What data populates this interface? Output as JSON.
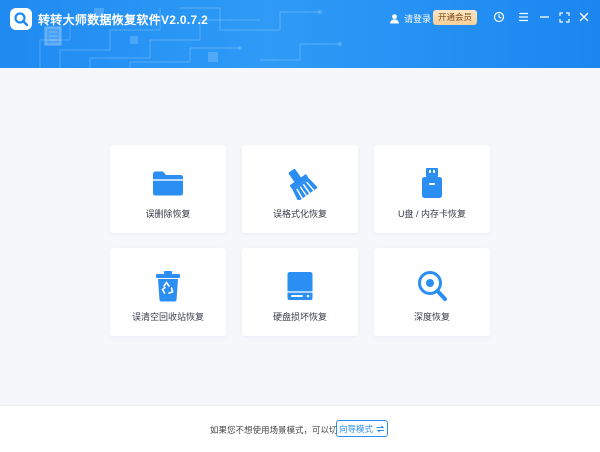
{
  "app": {
    "title": "转转大师数据恢复软件V2.0.7.2",
    "logo_icon": "q-magnifier-icon"
  },
  "header": {
    "login_label": "请登录",
    "vip_label": "开通会员",
    "icons": [
      "user-icon",
      "refresh-icon",
      "menu-icon",
      "minimize-icon",
      "maximize-icon",
      "close-icon"
    ]
  },
  "modes": [
    {
      "label": "误删除恢复",
      "icon": "folder-icon"
    },
    {
      "label": "误格式化恢复",
      "icon": "broom-icon"
    },
    {
      "label": "U盘 / 内存卡恢复",
      "icon": "usb-drive-icon"
    },
    {
      "label": "误清空回收站恢复",
      "icon": "recycle-bin-icon"
    },
    {
      "label": "硬盘损坏恢复",
      "icon": "hard-disk-icon"
    },
    {
      "label": "深度恢复",
      "icon": "deep-scan-icon"
    }
  ],
  "footer": {
    "hint": "如果您不想使用场景模式，可以切换至",
    "wizard_label": "向导模式"
  },
  "colors": {
    "accent": "#2a8ff3",
    "header_start": "#1f8bf2",
    "icon_blue": "#2b8ef3",
    "vip_gold": "#f6cf9a",
    "background": "#f5f7fb"
  }
}
